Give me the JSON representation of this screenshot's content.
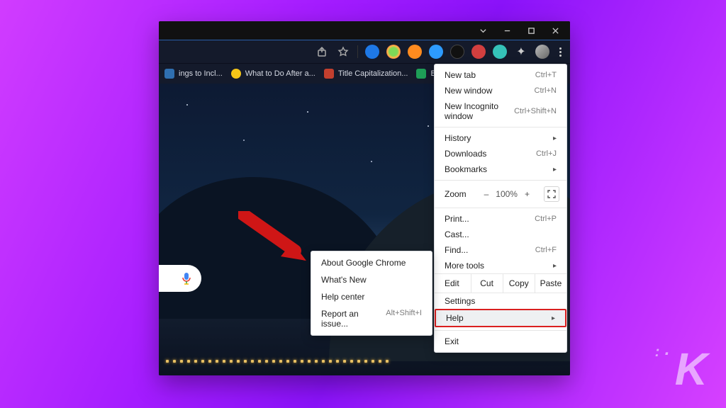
{
  "window_controls": {
    "caret_icon": "chevron-down",
    "minimize": "–",
    "maximize": "▢",
    "close": "✕"
  },
  "toolbar": {
    "share_icon": "share-icon",
    "star_icon": "star-icon",
    "extensions": [
      "ext-blue",
      "ext-green",
      "ext-orange",
      "ext-dl",
      "ext-dark",
      "ext-red",
      "ext-teal",
      "ext-puzzle",
      "ext-avatar"
    ],
    "menu_icon": "kebab-icon"
  },
  "bookmarks": [
    {
      "label": "ings to Incl...",
      "favcolor": "#2f6fb0"
    },
    {
      "label": "What to Do After a...",
      "favcolor": "#f5c518"
    },
    {
      "label": "Title Capitalization...",
      "favcolor": "#c23f2e"
    },
    {
      "label": "Backlog - Google...",
      "favcolor": "#1e9e57"
    }
  ],
  "main_menu": {
    "new_tab": {
      "label": "New tab",
      "shortcut": "Ctrl+T"
    },
    "new_window": {
      "label": "New window",
      "shortcut": "Ctrl+N"
    },
    "incognito": {
      "label": "New Incognito window",
      "shortcut": "Ctrl+Shift+N"
    },
    "history": {
      "label": "History"
    },
    "downloads": {
      "label": "Downloads",
      "shortcut": "Ctrl+J"
    },
    "bookmarks": {
      "label": "Bookmarks"
    },
    "zoom": {
      "label": "Zoom",
      "minus": "–",
      "value": "100%",
      "plus": "+"
    },
    "print": {
      "label": "Print...",
      "shortcut": "Ctrl+P"
    },
    "cast": {
      "label": "Cast..."
    },
    "find": {
      "label": "Find...",
      "shortcut": "Ctrl+F"
    },
    "more_tools": {
      "label": "More tools"
    },
    "edit": {
      "label": "Edit",
      "cut": "Cut",
      "copy": "Copy",
      "paste": "Paste"
    },
    "settings": {
      "label": "Settings"
    },
    "help": {
      "label": "Help"
    },
    "exit": {
      "label": "Exit"
    }
  },
  "help_submenu": {
    "about": {
      "label": "About Google Chrome"
    },
    "whats_new": {
      "label": "What's New"
    },
    "help_center": {
      "label": "Help center"
    },
    "report": {
      "label": "Report an issue...",
      "shortcut": "Alt+Shift+I"
    }
  },
  "watermark": "K"
}
